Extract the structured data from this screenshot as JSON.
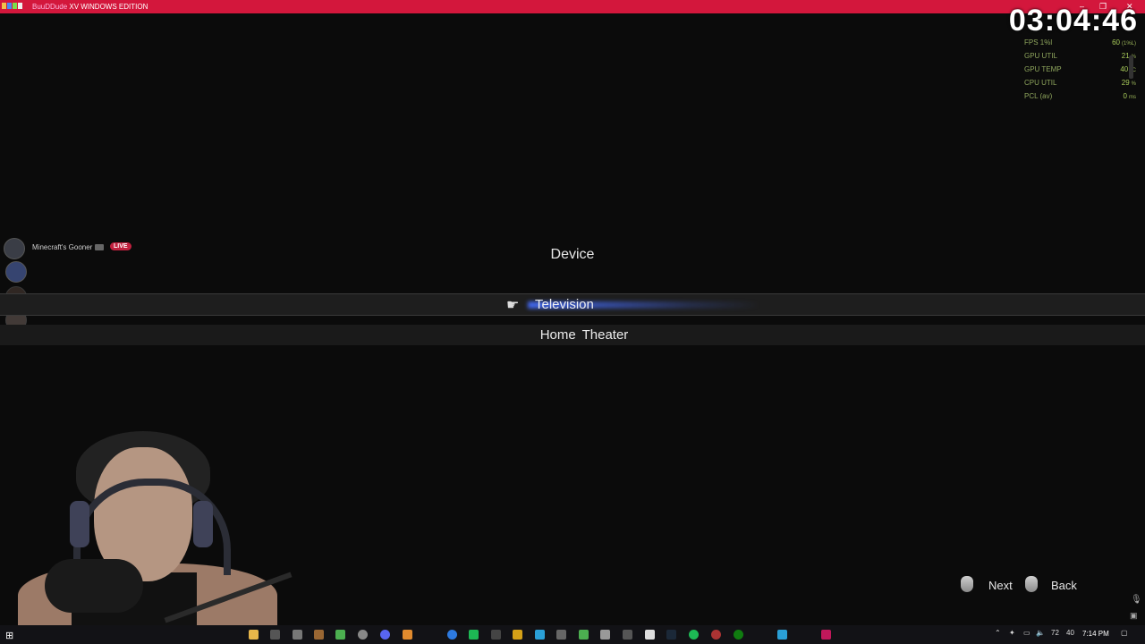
{
  "window": {
    "title_brand": "BuuDDude",
    "title_rest": " XV WINDOWS EDITION"
  },
  "clock": "03:04:46",
  "perf": [
    {
      "label": "FPS 1%l",
      "value": "60",
      "unit": "(1%L)"
    },
    {
      "label": "GPU UTIL",
      "value": "21",
      "unit": "%"
    },
    {
      "label": "GPU TEMP",
      "value": "40",
      "unit": "°C"
    },
    {
      "label": "CPU UTIL",
      "value": "29",
      "unit": "%"
    },
    {
      "label": "PCL (av)",
      "value": "0",
      "unit": "ms"
    }
  ],
  "stream": {
    "channel": "Minecraft's Gooner",
    "live_badge": "LIVE"
  },
  "menu": {
    "heading": "Device",
    "options": [
      {
        "label": "Television",
        "selected": true
      },
      {
        "label": "Home Theater",
        "selected": false
      }
    ]
  },
  "prompts": {
    "next": "Next",
    "back": "Back"
  },
  "taskbar": {
    "temp": "72",
    "temp2": "40",
    "time": "7:14 PM"
  },
  "colors": {
    "titlebar": "#d3173c",
    "perf_text": "#a8cb5a",
    "selection_glow": "#466eff"
  }
}
